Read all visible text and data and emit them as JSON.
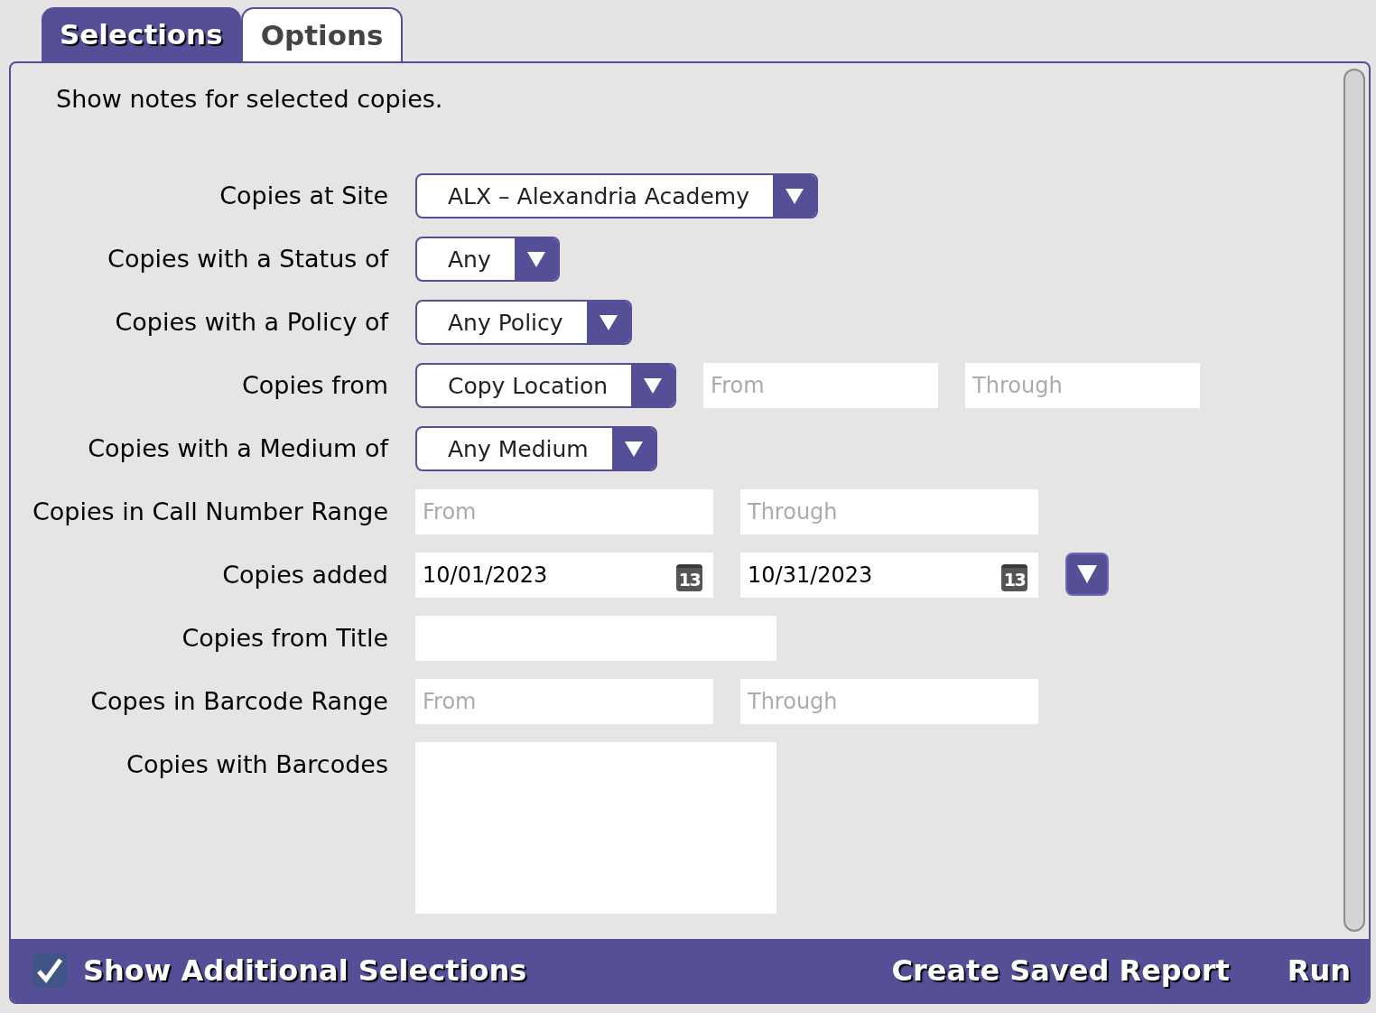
{
  "tabs": [
    {
      "label": "Selections",
      "selected": true
    },
    {
      "label": "Options",
      "selected": false
    }
  ],
  "description": "Show notes for selected copies.",
  "rows": [
    {
      "label": "Copies at Site",
      "fields": [
        {
          "kind": "select",
          "value": "ALX – Alexandria Academy"
        }
      ]
    },
    {
      "label": "Copies with a Status of",
      "fields": [
        {
          "kind": "select",
          "value": "Any"
        }
      ]
    },
    {
      "label": "Copies with a Policy of",
      "fields": [
        {
          "kind": "select",
          "value": "Any Policy"
        }
      ]
    },
    {
      "label": "Copies from",
      "fields": [
        {
          "kind": "select",
          "value": "Copy Location"
        },
        {
          "kind": "text",
          "placeholder": "From"
        },
        {
          "kind": "text",
          "placeholder": "Through"
        }
      ]
    },
    {
      "label": "Copies with a Medium of",
      "fields": [
        {
          "kind": "select",
          "value": "Any Medium"
        }
      ]
    },
    {
      "label": "Copies in Call Number Range",
      "fields": [
        {
          "kind": "text",
          "placeholder": "From"
        },
        {
          "kind": "text",
          "placeholder": "Through"
        }
      ]
    },
    {
      "label": "Copies added",
      "fields": [
        {
          "kind": "date",
          "value": "10/01/2023",
          "calendar_day": "13"
        },
        {
          "kind": "date",
          "value": "10/31/2023",
          "calendar_day": "13"
        },
        {
          "kind": "menu"
        }
      ]
    },
    {
      "label": "Copies from Title",
      "fields": [
        {
          "kind": "text"
        }
      ]
    },
    {
      "label": "Copes in Barcode Range",
      "fields": [
        {
          "kind": "text",
          "placeholder": "From"
        },
        {
          "kind": "text",
          "placeholder": "Through"
        }
      ]
    },
    {
      "label": "Copies with Barcodes",
      "fields": [
        {
          "kind": "textarea"
        }
      ]
    }
  ],
  "footer": {
    "checkbox": {
      "label": "Show Additional Selections",
      "checked": true
    },
    "buttons": [
      "Create Saved Report",
      "Run"
    ]
  }
}
